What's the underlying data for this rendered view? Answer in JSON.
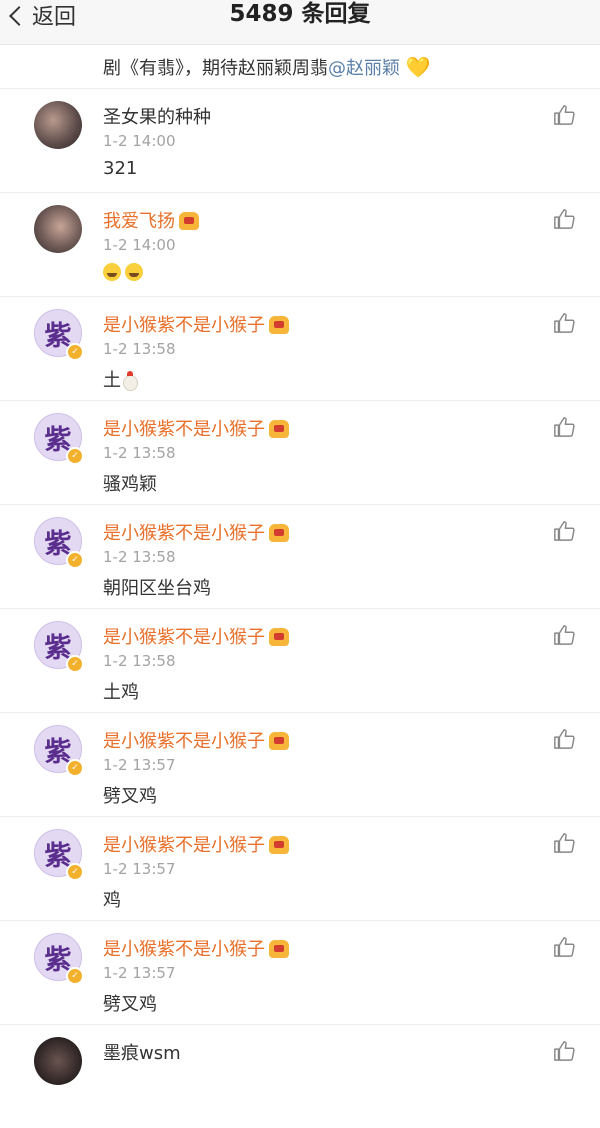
{
  "header": {
    "back_label": "返回",
    "title": "5489 条回复"
  },
  "top_comment": {
    "text": "剧《有翡》，期待赵丽颖周翡",
    "mention": "@赵丽颖",
    "emoji": "yellow-heart-icon"
  },
  "replies": [
    {
      "name": "圣女果的种种",
      "time": "1-2 14:00",
      "content": "321",
      "avatar": "photo",
      "vip": false
    },
    {
      "name": "我爱飞扬",
      "time": "1-2 14:00",
      "content": "",
      "content_emoji": [
        "laugh-cry-emoji",
        "laugh-cry-emoji"
      ],
      "avatar": "photo",
      "vip": true
    },
    {
      "name": "是小猴紫不是小猴子",
      "time": "1-2 13:58",
      "content": "土",
      "content_emoji": [
        "rooster-emoji"
      ],
      "avatar": "紫",
      "vip": true
    },
    {
      "name": "是小猴紫不是小猴子",
      "time": "1-2 13:58",
      "content": "骚鸡颖",
      "avatar": "紫",
      "vip": true
    },
    {
      "name": "是小猴紫不是小猴子",
      "time": "1-2 13:58",
      "content": "朝阳区坐台鸡",
      "avatar": "紫",
      "vip": true
    },
    {
      "name": "是小猴紫不是小猴子",
      "time": "1-2 13:58",
      "content": "土鸡",
      "avatar": "紫",
      "vip": true
    },
    {
      "name": "是小猴紫不是小猴子",
      "time": "1-2 13:57",
      "content": "劈叉鸡",
      "avatar": "紫",
      "vip": true
    },
    {
      "name": "是小猴紫不是小猴子",
      "time": "1-2 13:57",
      "content": "鸡",
      "avatar": "紫",
      "vip": true
    },
    {
      "name": "是小猴紫不是小猴子",
      "time": "1-2 13:57",
      "content": "劈叉鸡",
      "avatar": "紫",
      "vip": true
    },
    {
      "name": "墨痕wsm",
      "time": "",
      "content": "",
      "avatar": "photo",
      "vip": false
    }
  ],
  "colors": {
    "vip_name": "#e8702a",
    "mention": "#5b7fa8",
    "time": "#a3a3a3",
    "avatar_zi_bg": "#e4d9f3"
  }
}
